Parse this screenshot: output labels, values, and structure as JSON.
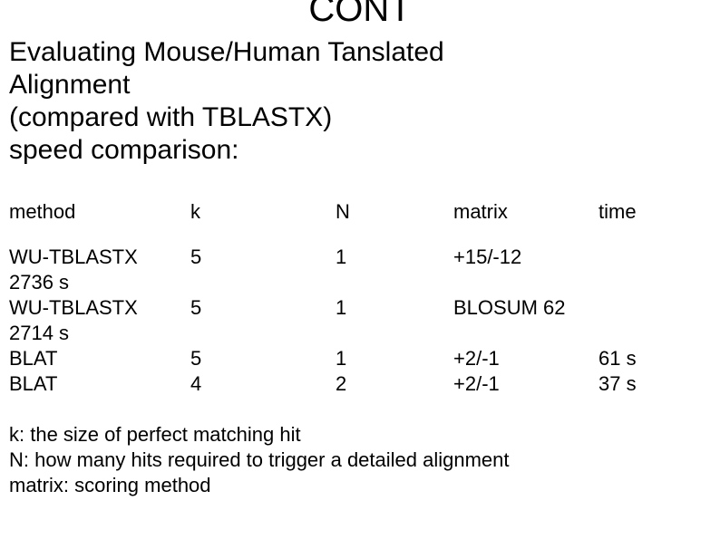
{
  "top_title": "CONT",
  "subtitle_lines": [
    "Evaluating Mouse/Human Tanslated",
    "Alignment",
    "(compared with TBLASTX)",
    "speed comparison:"
  ],
  "headers": {
    "method": "method",
    "k": "k",
    "N": "N",
    "matrix": "matrix",
    "time": "time"
  },
  "chart_data": {
    "type": "table",
    "columns": [
      "method",
      "k",
      "N",
      "matrix",
      "time"
    ],
    "rows": [
      {
        "method": "WU-TBLASTX",
        "k": "5",
        "N": "1",
        "matrix": "+15/-12",
        "time": "",
        "method_extra": "2736 s"
      },
      {
        "method": "WU-TBLASTX",
        "k": "5",
        "N": "1",
        "matrix": "BLOSUM 62",
        "time": "",
        "method_extra": "2714 s"
      },
      {
        "method": "BLAT",
        "k": "5",
        "N": "1",
        "matrix": "+2/-1",
        "time": "61 s",
        "method_extra": ""
      },
      {
        "method": "BLAT",
        "k": "4",
        "N": "2",
        "matrix": "+2/-1",
        "time": "37 s",
        "method_extra": ""
      }
    ]
  },
  "footnotes": [
    "k: the size of perfect matching hit",
    "N: how many hits required to trigger a detailed alignment",
    "matrix: scoring method"
  ]
}
